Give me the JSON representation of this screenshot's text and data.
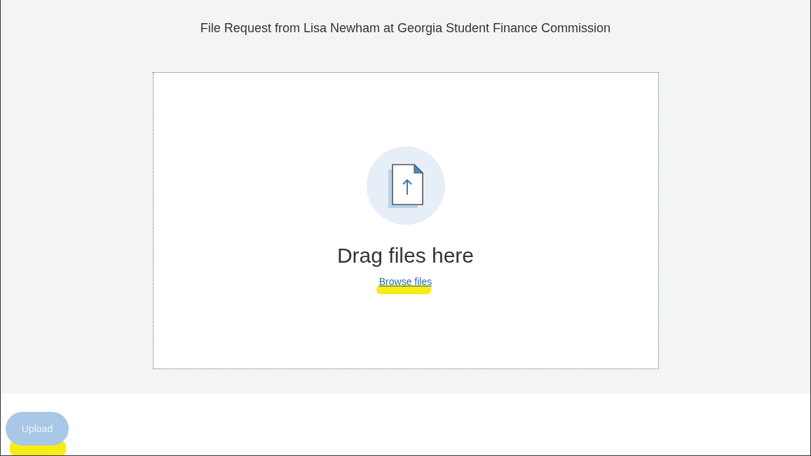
{
  "title": "File Request from Lisa Newham at Georgia Student Finance Commission",
  "dropzone": {
    "heading": "Drag files here",
    "link": "Browse files"
  },
  "upload_button": {
    "label": "Upload",
    "disabled": true
  }
}
